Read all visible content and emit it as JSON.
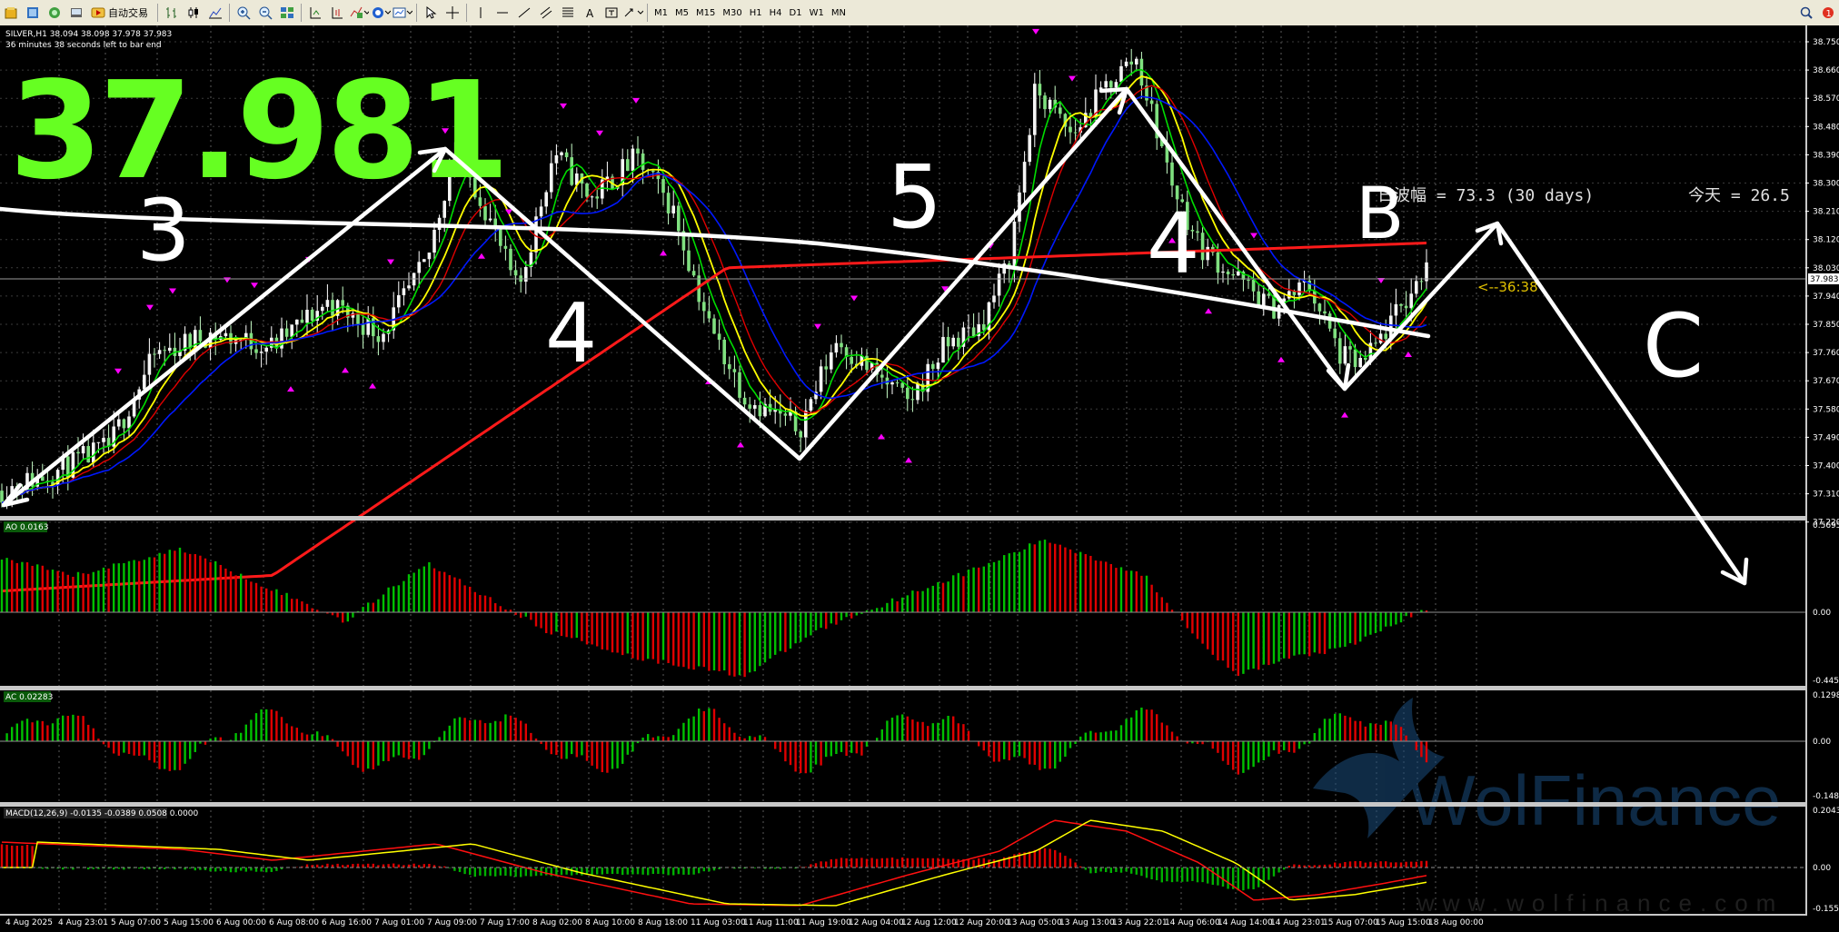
{
  "toolbar": {
    "autotrade_label": "自动交易",
    "timeframes": [
      "M1",
      "M5",
      "M15",
      "M30",
      "H1",
      "H4",
      "D1",
      "W1",
      "MN"
    ]
  },
  "chart": {
    "header_line1": "SILVER,H1  38.094 38.098 37.978 37.983",
    "header_line2": "36 minutes 38 seconds left to bar end",
    "big_price": "37.981",
    "range_text": "日波幅 = 73.3   (30 days)",
    "today_text": "今天 = 26.5",
    "timer_text": "<--36:38",
    "current_price": "37.983",
    "price_ticks": [
      "38.750",
      "38.660",
      "38.570",
      "38.480",
      "38.390",
      "38.300",
      "38.210",
      "38.120",
      "38.030",
      "37.940",
      "37.850",
      "37.760",
      "37.670",
      "37.580",
      "37.490",
      "37.400",
      "37.310",
      "37.220"
    ],
    "time_labels": [
      "4 Aug 2025",
      "4 Aug 23:01",
      "5 Aug 07:00",
      "5 Aug 15:00",
      "6 Aug 00:00",
      "6 Aug 08:00",
      "6 Aug 16:00",
      "7 Aug 01:00",
      "7 Aug 09:00",
      "7 Aug 17:00",
      "8 Aug 02:00",
      "8 Aug 10:00",
      "8 Aug 18:00",
      "11 Aug 03:00",
      "11 Aug 11:00",
      "11 Aug 19:00",
      "12 Aug 04:00",
      "12 Aug 12:00",
      "12 Aug 20:00",
      "13 Aug 05:00",
      "13 Aug 13:00",
      "13 Aug 22:01",
      "14 Aug 06:00",
      "14 Aug 14:00",
      "14 Aug 23:01",
      "15 Aug 07:00",
      "15 Aug 15:00",
      "18 Aug 00:00"
    ],
    "wave_labels": [
      "3",
      "4",
      "5",
      "4",
      "B",
      "C"
    ],
    "colors": {
      "bull": "#00ff00",
      "bear": "#ff0000",
      "ma_green": "#00dd00",
      "ma_yellow": "#ffff00",
      "ma_red": "#e00000",
      "ma_blue": "#0018ff",
      "ma_long": "#ff1a1a",
      "big_price": "#66ff22",
      "arrow": "#ff00ff"
    }
  },
  "ao": {
    "label": "AO 0.0163",
    "ticks": [
      "0.5695",
      "0.00",
      "-0.4455"
    ]
  },
  "ac": {
    "label": "AC 0.02283",
    "ticks": [
      "0.12988",
      "0.00",
      "-0.14862"
    ]
  },
  "macd": {
    "label": "MACD(12,26,9) -0.0135 -0.0389 0.0508 0.0000",
    "ticks": [
      "0.2043",
      "0.00",
      "-0.1558"
    ]
  },
  "watermark": {
    "brand": "WolFinance",
    "url": "www.wolfinance.com"
  }
}
